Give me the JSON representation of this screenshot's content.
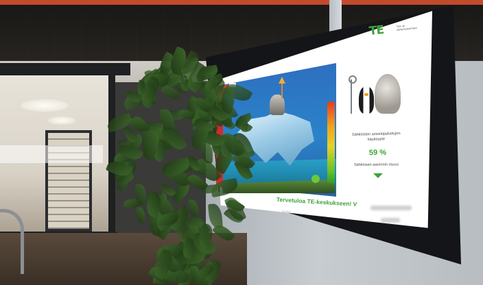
{
  "screen": {
    "logo": "TE",
    "logo_subtitle": "Työ- ja elinkeinotoimisto",
    "status_line_1": "Sähköisten asiointipalvelujen",
    "status_line_2": "käyttöaste",
    "percent": "59 %",
    "target_label": "Sähköisen asioinnin osuus",
    "welcome": "Tervetuloa TE-keskukseen! V",
    "brand": "SONY"
  },
  "colors": {
    "accent_green": "#3da33a",
    "top_band": "#c24a2c"
  },
  "icons": [
    "down-arrow-icon"
  ]
}
